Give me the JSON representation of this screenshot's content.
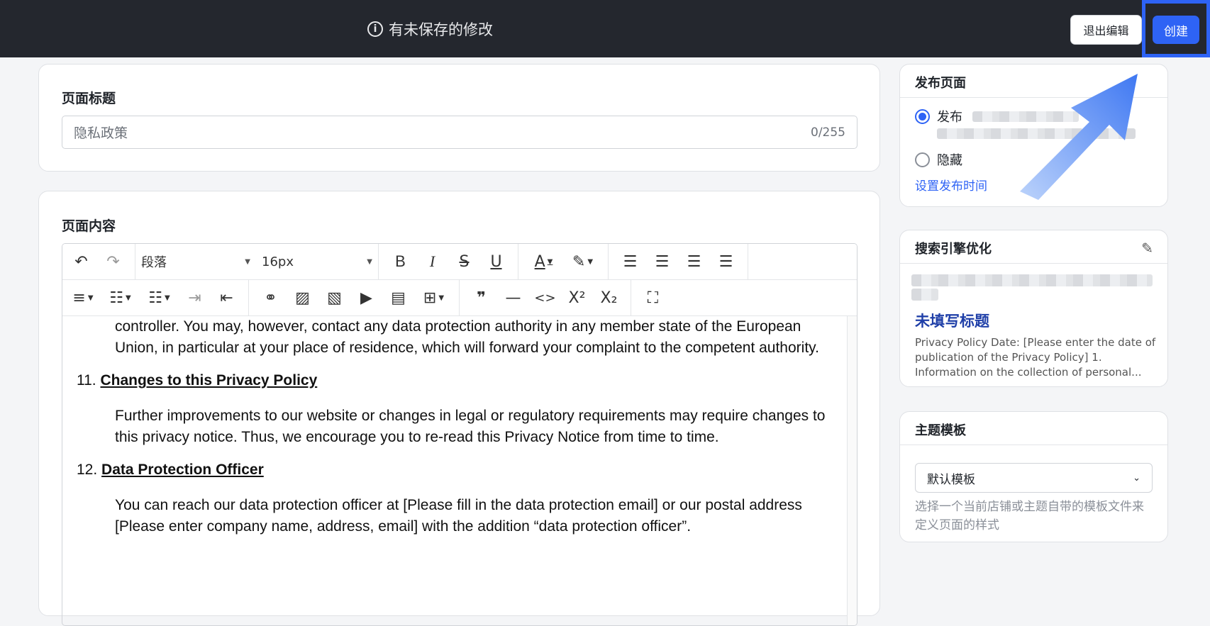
{
  "topbar": {
    "unsaved_text": "有未保存的修改",
    "exit_label": "退出编辑",
    "create_label": "创建"
  },
  "title_card": {
    "label": "页面标题",
    "placeholder": "隐私政策",
    "counter": "0/255"
  },
  "content_card": {
    "label": "页面内容",
    "toolbar": {
      "paragraph_select": "段落",
      "font_size_select": "16px"
    },
    "doc": {
      "para_intro": "controller. You may, however, contact any data protection authority in any member state of the European Union, in particular at your place of residence, which will forward your complaint to the competent authority.",
      "sec11_num": "11.",
      "sec11_title": "Changes to this Privacy Policy",
      "sec11_body": "Further improvements to our website or changes in legal or regulatory requirements may require changes to this privacy notice. Thus, we encourage you to re-read this Privacy Notice from time to time.",
      "sec12_num": "12.",
      "sec12_title": "Data Protection Officer",
      "sec12_body": "You can reach our data protection officer at [Please fill in the data protection email] or our postal address  [Please enter company name, address, email] with the addition “data protection officer”."
    }
  },
  "publish_card": {
    "title": "发布页面",
    "option_publish": "发布",
    "option_hide": "隐藏",
    "schedule_link": "设置发布时间",
    "selected": "发布"
  },
  "seo_card": {
    "title": "搜索引擎优化",
    "page_title": "未填写标题",
    "description": "Privacy Policy Date: [Please enter the date of publication of the Privacy Policy] 1. Information on the collection of personal..."
  },
  "template_card": {
    "title": "主题模板",
    "selected": "默认模板",
    "help": "选择一个当前店铺或主题自带的模板文件来定义页面的样式"
  },
  "colors": {
    "accent": "#2e63f5",
    "topbar": "#24272e"
  }
}
